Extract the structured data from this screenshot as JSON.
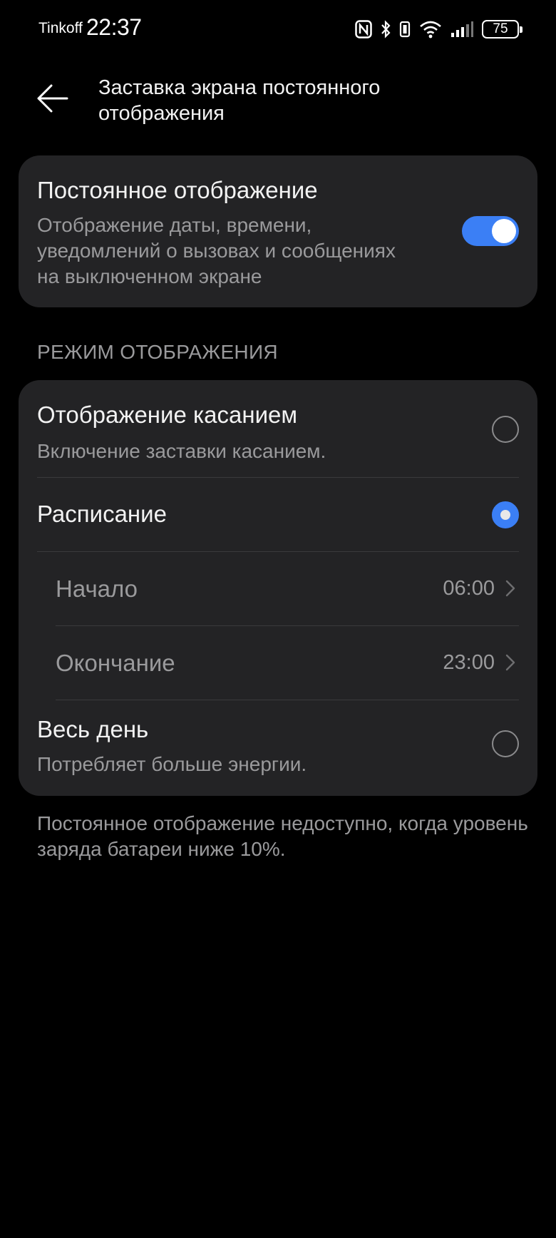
{
  "status_bar": {
    "carrier": "Tinkoff",
    "time": "22:37",
    "battery_level": "75",
    "icons": [
      "nfc-icon",
      "bluetooth-icon",
      "vibrate-icon",
      "wifi-icon",
      "signal-icon",
      "battery-icon"
    ]
  },
  "header": {
    "back_icon": "back-arrow-icon",
    "title": "Заставка экрана постоянного отображения"
  },
  "aod_card": {
    "title": "Постоянное отображение",
    "description": "Отображение даты, времени, уведомлений о вызовах и сообщениях на выключенном экране",
    "toggle_on": true
  },
  "mode_section": {
    "header": "РЕЖИМ ОТОБРАЖЕНИЯ",
    "options": [
      {
        "title": "Отображение касанием",
        "subtitle": "Включение заставки касанием.",
        "selected": false
      },
      {
        "title": "Расписание",
        "subtitle": "",
        "selected": true
      },
      {
        "title": "Весь день",
        "subtitle": "Потребляет больше энергии.",
        "selected": false
      }
    ],
    "schedule": {
      "start_label": "Начало",
      "start_value": "06:00",
      "end_label": "Окончание",
      "end_value": "23:00"
    }
  },
  "footer_note": "Постоянное отображение недоступно, когда уровень заряда батареи ниже 10%.",
  "colors": {
    "background": "#000000",
    "card": "#232325",
    "accent": "#3b7ff5",
    "primary_text": "#f2f2f2",
    "secondary_text": "#9a9a9c"
  }
}
